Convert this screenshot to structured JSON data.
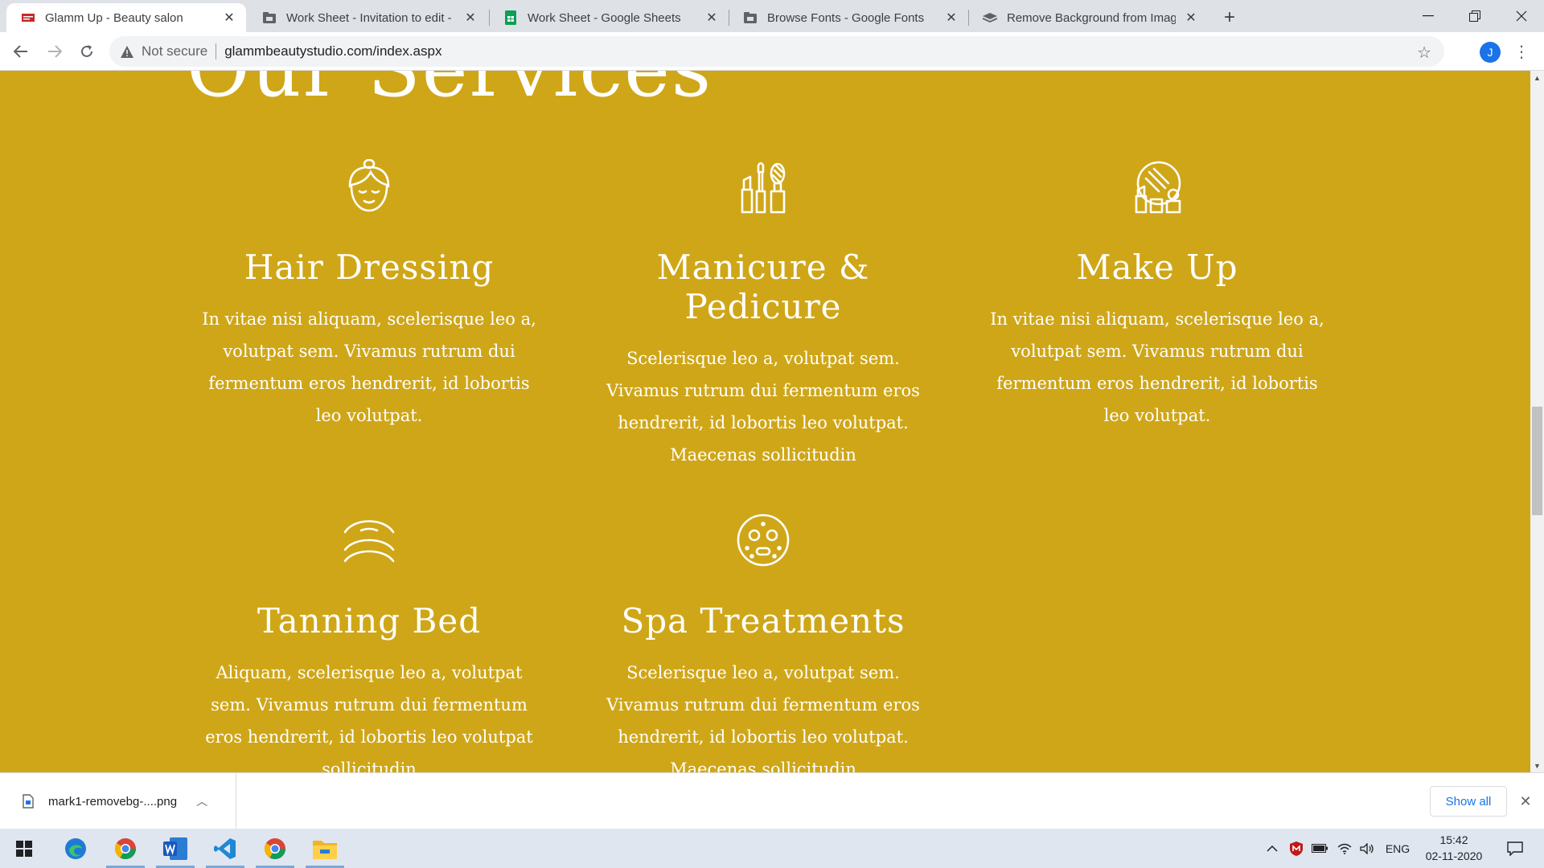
{
  "browser": {
    "tabs": [
      {
        "title": "Glamm Up - Beauty salon",
        "active": true,
        "favicon": "salon-favicon"
      },
      {
        "title": "Work Sheet - Invitation to edit - J",
        "active": false,
        "favicon": "drive-icon"
      },
      {
        "title": "Work Sheet - Google Sheets",
        "active": false,
        "favicon": "sheets-icon"
      },
      {
        "title": "Browse Fonts - Google Fonts",
        "active": false,
        "favicon": "drive-icon"
      },
      {
        "title": "Remove Background from Image",
        "active": false,
        "favicon": "removebg-icon"
      }
    ],
    "address": {
      "security_label": "Not secure",
      "url": "glammbeautystudio.com/index.aspx"
    },
    "profile_initial": "J"
  },
  "page": {
    "section_heading": "Our Services",
    "accent_color": "#cfa618",
    "services": [
      {
        "icon": "face-icon",
        "title": "Hair Dressing",
        "description": "In vitae nisi aliquam, scelerisque leo a, volutpat sem. Vivamus rutrum dui fermentum eros hendrerit, id lobortis leo volutpat."
      },
      {
        "icon": "cosmetics-icon",
        "title": "Manicure & Pedicure",
        "description": "Scelerisque leo a, volutpat sem. Vivamus rutrum dui fermentum eros hendrerit, id lobortis leo volutpat. Maecenas sollicitudin"
      },
      {
        "icon": "makeup-mirror-icon",
        "title": "Make Up",
        "description": "In vitae nisi aliquam, scelerisque leo a, volutpat sem. Vivamus rutrum dui fermentum eros hendrerit, id lobortis leo volutpat."
      },
      {
        "icon": "eyelid-icon",
        "title": "Tanning Bed",
        "description": "Aliquam, scelerisque leo a, volutpat sem. Vivamus rutrum dui fermentum eros hendrerit, id lobortis leo volutpat sollicitudin"
      },
      {
        "icon": "face-mask-icon",
        "title": "Spa Treatments",
        "description": "Scelerisque leo a, volutpat sem. Vivamus rutrum dui fermentum eros hendrerit, id lobortis leo volutpat. Maecenas sollicitudin"
      }
    ]
  },
  "downloads": {
    "file_name": "mark1-removebg-....png",
    "show_all": "Show all"
  },
  "taskbar": {
    "apps": [
      "windows-start-icon",
      "edge-icon",
      "chrome-profile-icon",
      "word-icon",
      "vscode-icon",
      "chrome-icon",
      "file-explorer-icon"
    ],
    "language": "ENG",
    "time": "15:42",
    "date": "02-11-2020"
  }
}
